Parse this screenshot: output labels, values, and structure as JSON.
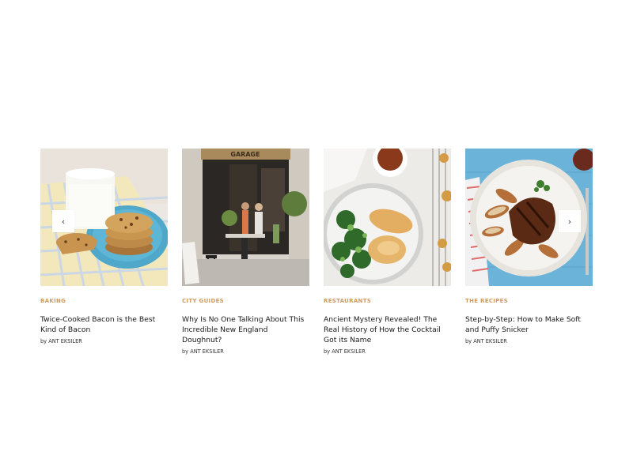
{
  "carousel": {
    "prev_icon": "‹",
    "next_icon": "›",
    "byline_prefix": "by",
    "cards": [
      {
        "category": "Baking",
        "title": "Twice-Cooked Bacon is the Best Kind of Bacon",
        "author": "ANT EKSILER",
        "image": "cookies-and-milk-photo"
      },
      {
        "category": "City Guides",
        "title": "Why Is No One Talking About This Incredible New England Doughnut?",
        "author": "ANT EKSILER",
        "image": "cafe-storefront-photo",
        "sign": "GARAGE"
      },
      {
        "category": "Restaurants",
        "title": "Ancient Mystery Revealed! The Real History of How the Cocktail Got its Name",
        "author": "ANT EKSILER",
        "image": "chicken-salad-photo"
      },
      {
        "category": "The Recipes",
        "title": "Step-by-Step: How to Make Soft and Puffy Snicker",
        "author": "ANT EKSILER",
        "image": "steak-potatoes-photo"
      }
    ]
  }
}
